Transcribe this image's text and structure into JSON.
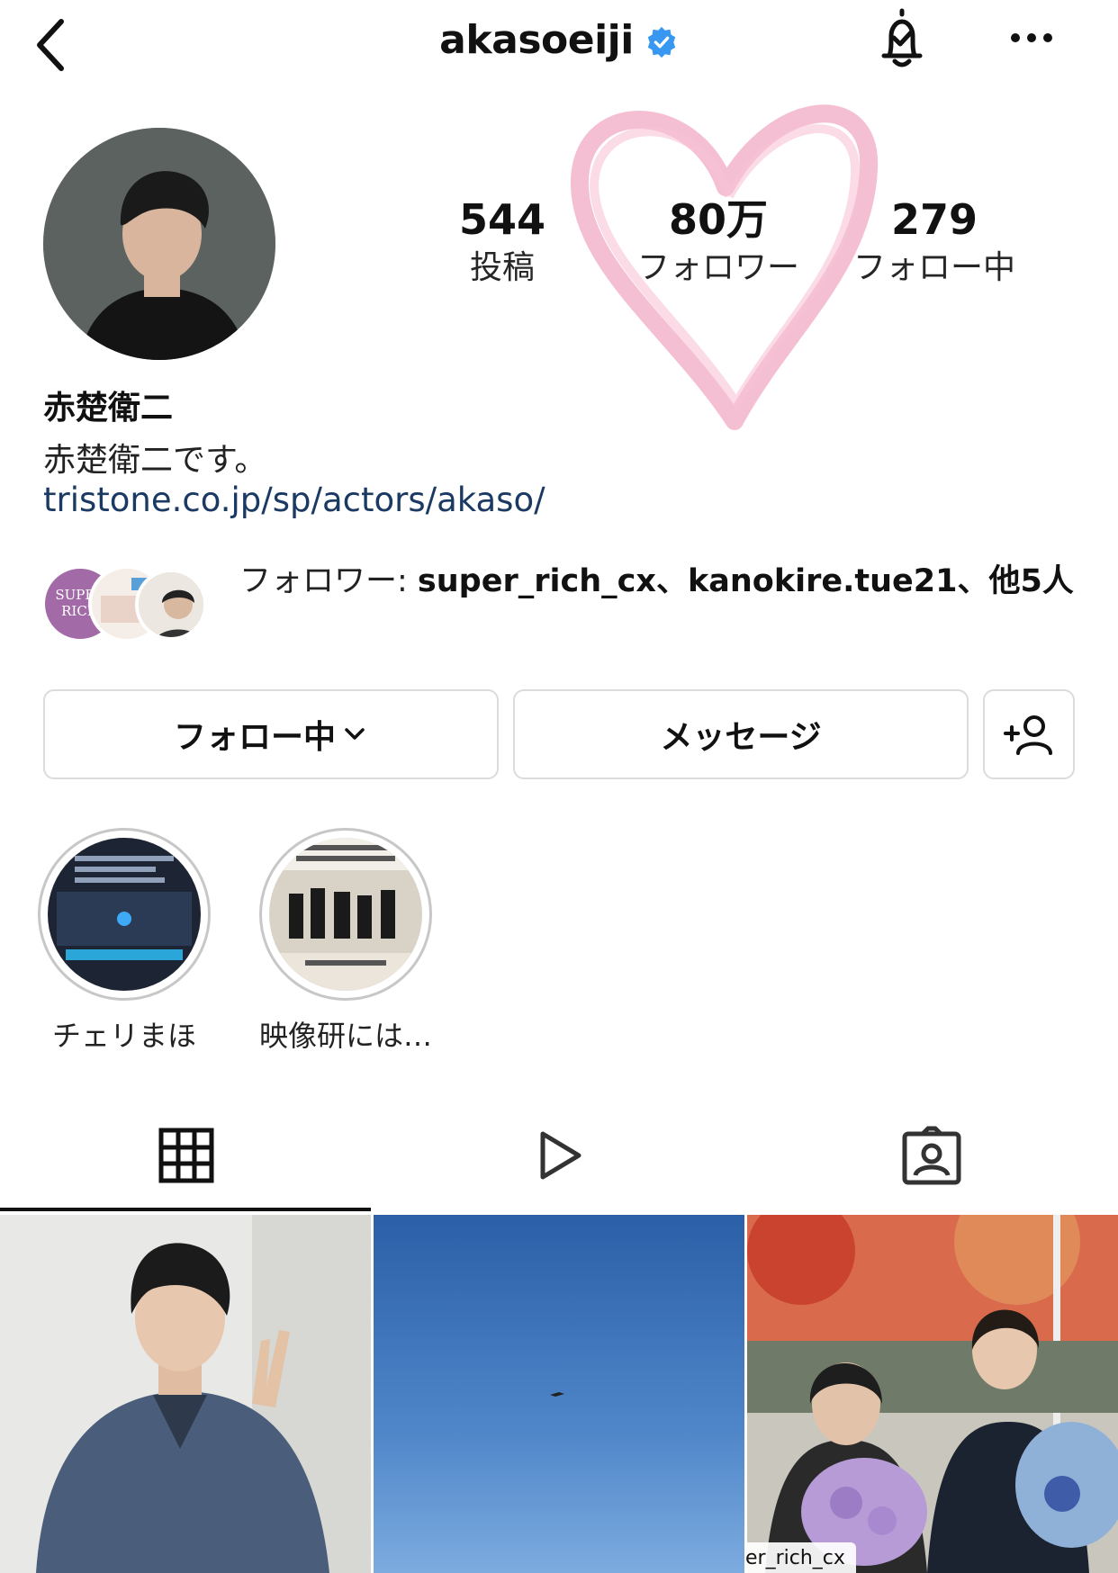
{
  "header": {
    "username": "akasoeiji",
    "icons": {
      "back": "chevron-left-icon",
      "verified": "verified-badge-icon",
      "notifications": "bell-check-icon",
      "more": "more-horizontal-icon"
    }
  },
  "profile": {
    "stats": {
      "posts": {
        "value": "544",
        "label": "投稿"
      },
      "followers": {
        "value": "80万",
        "label": "フォロワー"
      },
      "following": {
        "value": "279",
        "label": "フォロー中"
      }
    },
    "display_name": "赤楚衛二",
    "bio": "赤楚衛二です。",
    "link": "tristone.co.jp/sp/actors/akaso/",
    "followed_by": {
      "prefix": "フォロワー: ",
      "accounts": "super_rich_cx、kanokire.tue21",
      "suffix": "、他5人",
      "avatar_1_text": "SUPER RICH"
    }
  },
  "actions": {
    "follow_label": "フォロー中",
    "message_label": "メッセージ"
  },
  "highlights": [
    {
      "label": "チェリまほ"
    },
    {
      "label": "映像研には…"
    }
  ],
  "tabs": [
    "grid-icon",
    "reels-icon",
    "tagged-icon"
  ],
  "posts": [
    {
      "kind": "portrait"
    },
    {
      "kind": "sky"
    },
    {
      "kind": "bouquet",
      "tag": "er_rich_cx"
    }
  ],
  "colors": {
    "link": "#1b3a63",
    "verified": "#3897f0",
    "border": "#dbdbdb",
    "heart": "#f2a9c4"
  }
}
